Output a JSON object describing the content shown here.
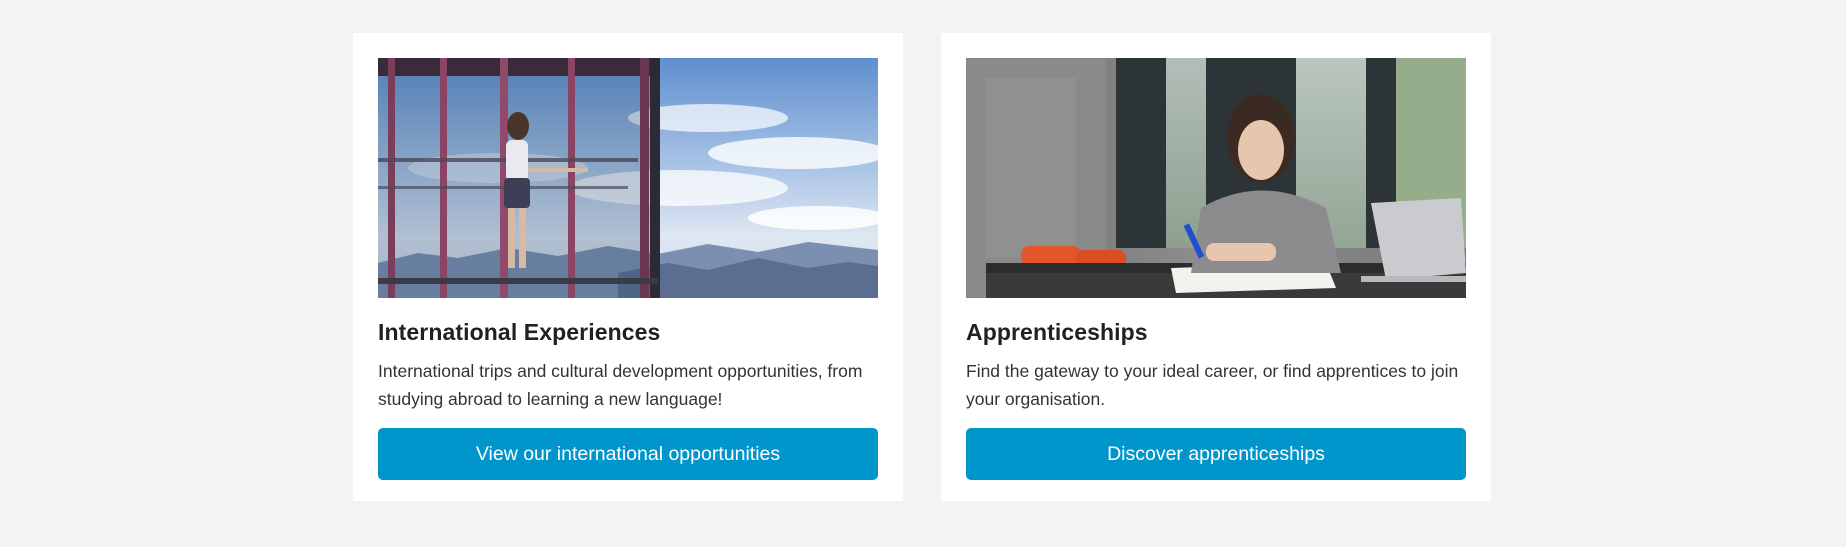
{
  "cards": [
    {
      "image_alt": "Woman standing on glass observation deck overlooking mountains",
      "title": "International Experiences",
      "description": "International trips and cultural development opportunities, from studying abroad to learning a new language!",
      "button_label": "View our international opportunities"
    },
    {
      "image_alt": "Student writing in notebook next to laptop",
      "title": "Apprenticeships",
      "description": "Find the gateway to your ideal career, or find apprentices to join your organisation.",
      "button_label": "Discover apprenticeships"
    }
  ],
  "colors": {
    "background": "#f3f3f3",
    "card": "#ffffff",
    "button": "#0096cc",
    "title": "#212121"
  }
}
